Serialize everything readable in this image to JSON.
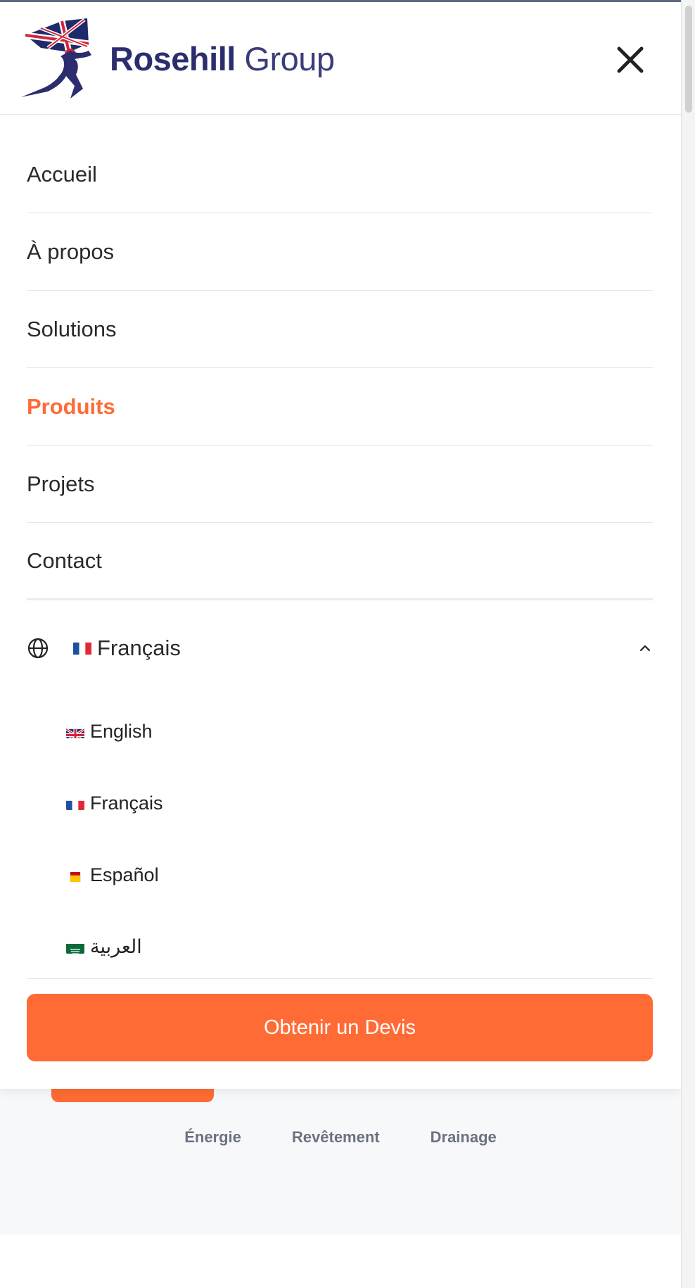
{
  "brand": {
    "name_bold": "Rosehill",
    "name_light": "Group",
    "accent_color": "#ff6b35",
    "logo_color": "#2b2d6e"
  },
  "header": {
    "close_icon": "close-icon"
  },
  "nav": {
    "items": [
      {
        "label": "Accueil"
      },
      {
        "label": "À propos"
      },
      {
        "label": "Solutions"
      },
      {
        "label": "Produits",
        "active": true
      },
      {
        "label": "Projets"
      },
      {
        "label": "Contact"
      }
    ]
  },
  "language": {
    "current": "Français",
    "globe_icon": "globe-icon",
    "expanded_icon": "chevron-up-icon",
    "options": [
      {
        "label": "English",
        "flag": "uk-flag-icon"
      },
      {
        "label": "Français",
        "flag": "france-flag-icon"
      },
      {
        "label": "Español",
        "flag": "spain-flag-icon"
      },
      {
        "label": "العربية",
        "flag": "saudi-flag-icon"
      }
    ]
  },
  "cta": {
    "label": "Obtenir un Devis"
  },
  "background_page": {
    "tags": [
      "Énergie",
      "Revêtement",
      "Drainage"
    ]
  }
}
